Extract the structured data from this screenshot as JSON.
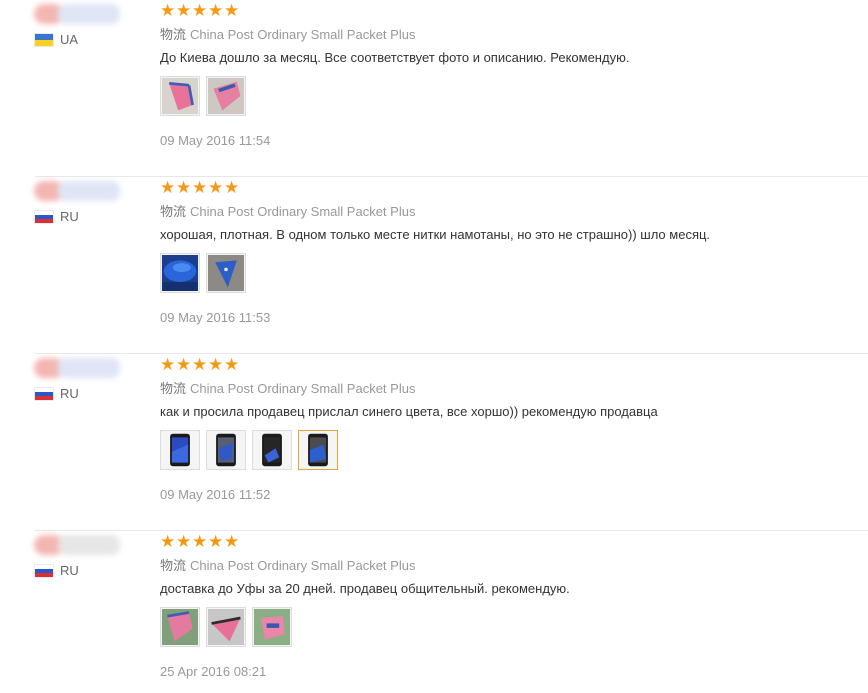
{
  "reviews": [
    {
      "country": "UA",
      "flag": "ua",
      "rating": 5,
      "logistics_label": "物流",
      "logistics": "China Post Ordinary Small Packet Plus",
      "feedback": "До Киева дошло за месяц. Все соответствует фото и описанию. Рекомендую.",
      "photos": [
        "pink-patch-photo",
        "pink-patch-photo"
      ],
      "date": "09 May 2016 11:54"
    },
    {
      "country": "RU",
      "flag": "ru",
      "rating": 5,
      "logistics_label": "物流",
      "logistics": "China Post Ordinary Small Packet Plus",
      "feedback": "хорошая, плотная. В одном только месте нитки намотаны, но это не страшно)) шло месяц.",
      "photos": [
        "blue-fabric-photo",
        "blue-patch-photo"
      ],
      "date": "09 May 2016 11:53"
    },
    {
      "country": "RU",
      "flag": "ru",
      "rating": 5,
      "logistics_label": "物流",
      "logistics": "China Post Ordinary Small Packet Plus",
      "feedback": "как и просила продавец прислал синего цвета, все хоршо)) рекомендую продавца",
      "photos": [
        "phone-blue-photo",
        "phone-blue-photo",
        "phone-blue-photo",
        "phone-blue-photo"
      ],
      "selected_photo": 4,
      "date": "09 May 2016 11:52"
    },
    {
      "country": "RU",
      "flag": "ru",
      "rating": 5,
      "logistics_label": "物流",
      "logistics": "China Post Ordinary Small Packet Plus",
      "feedback": "доставка до Уфы за 20 дней. продавец общительный. рекомендую.",
      "photos": [
        "pink-patch-photo",
        "pink-patch-photo",
        "pink-patch-photo"
      ],
      "date": "25 Apr 2016 08:21"
    }
  ],
  "colors": {
    "star": "#f39b17",
    "muted_text": "#999999",
    "body_text": "#333333",
    "selected_border": "#e5a33b"
  }
}
